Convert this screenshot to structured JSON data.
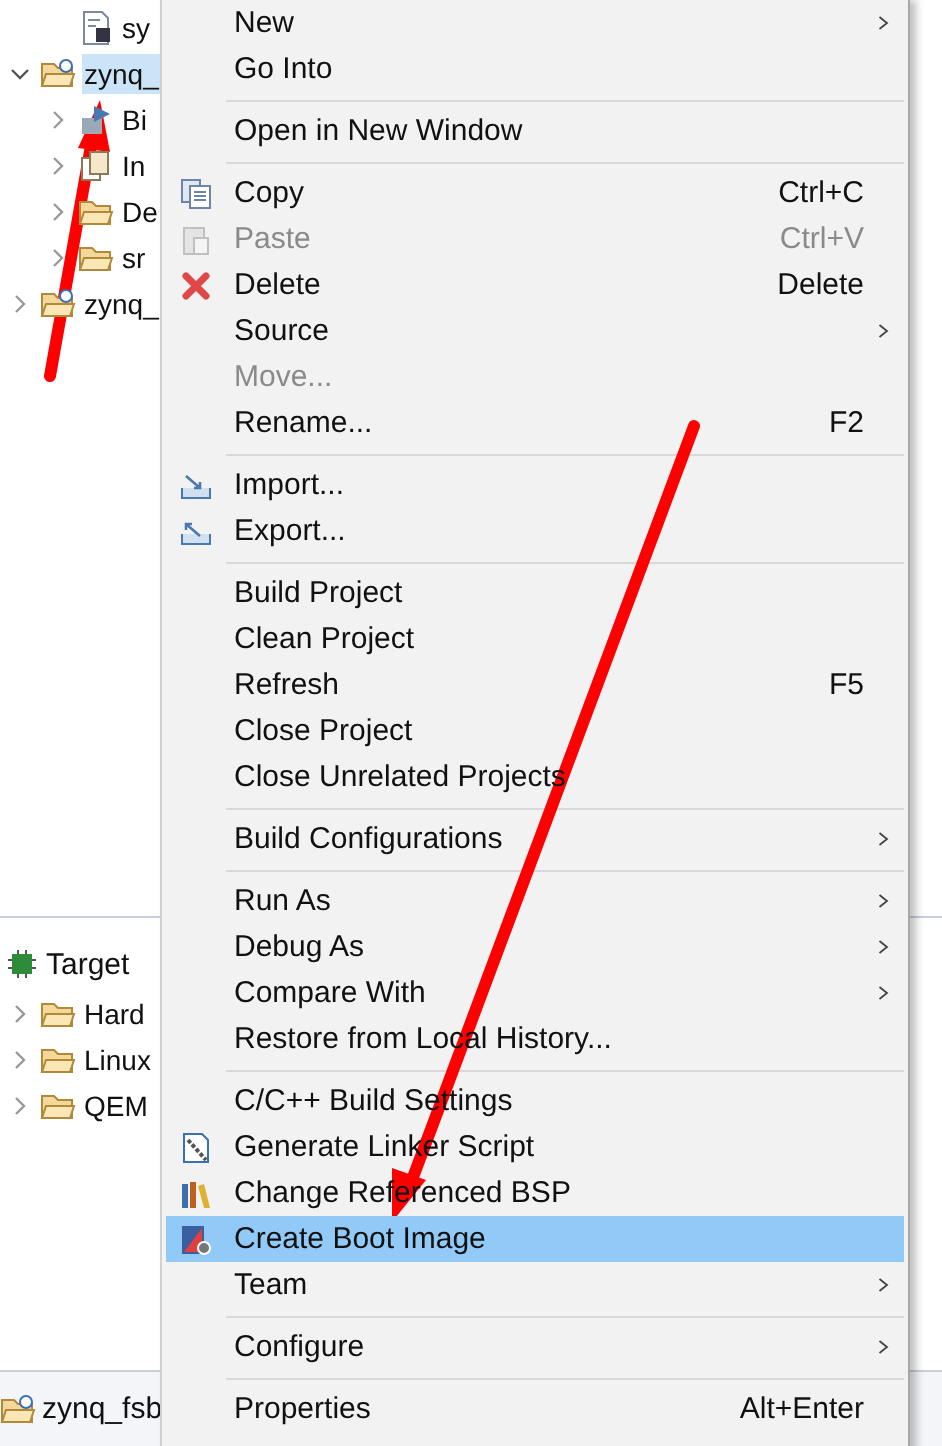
{
  "project_explorer": {
    "items": [
      {
        "label": "sy",
        "kind": "file",
        "selected": false
      },
      {
        "label": "zynq_",
        "kind": "project",
        "expanded": true,
        "selected": true,
        "children": [
          {
            "label": "Bi",
            "kind": "binaries",
            "expanded": false,
            "selected": false
          },
          {
            "label": "In",
            "kind": "includes",
            "expanded": false,
            "selected": false
          },
          {
            "label": "De",
            "kind": "folder",
            "expanded": false,
            "selected": false
          },
          {
            "label": "sr",
            "kind": "folder",
            "expanded": false,
            "selected": false
          }
        ]
      },
      {
        "label": "zynq_",
        "kind": "project",
        "expanded": false,
        "selected": false
      }
    ]
  },
  "target_panel": {
    "title": "Target",
    "items": [
      {
        "label": "Hard",
        "expanded": false
      },
      {
        "label": "Linux",
        "expanded": false
      },
      {
        "label": "QEM",
        "expanded": false
      }
    ]
  },
  "bottom_tab": {
    "label": "zynq_fsb"
  },
  "context_menu": {
    "items": [
      {
        "kind": "plain",
        "label": "New",
        "submenu": true,
        "disabled": false,
        "selected": false
      },
      {
        "kind": "plain",
        "label": "Go Into",
        "submenu": false,
        "disabled": false,
        "selected": false
      },
      {
        "kind": "separator"
      },
      {
        "kind": "plain",
        "label": "Open in New Window",
        "submenu": false,
        "disabled": false,
        "selected": false
      },
      {
        "kind": "separator"
      },
      {
        "kind": "copy",
        "label": "Copy",
        "shortcut": "Ctrl+C",
        "submenu": false,
        "disabled": false,
        "selected": false
      },
      {
        "kind": "paste",
        "label": "Paste",
        "shortcut": "Ctrl+V",
        "submenu": false,
        "disabled": true,
        "selected": false
      },
      {
        "kind": "delete",
        "label": "Delete",
        "shortcut": "Delete",
        "submenu": false,
        "disabled": false,
        "selected": false
      },
      {
        "kind": "plain",
        "label": "Source",
        "submenu": true,
        "disabled": false,
        "selected": false
      },
      {
        "kind": "plain",
        "label": "Move...",
        "submenu": false,
        "disabled": true,
        "selected": false
      },
      {
        "kind": "plain",
        "label": "Rename...",
        "shortcut": "F2",
        "submenu": false,
        "disabled": false,
        "selected": false
      },
      {
        "kind": "separator"
      },
      {
        "kind": "import",
        "label": "Import...",
        "submenu": false,
        "disabled": false,
        "selected": false
      },
      {
        "kind": "export",
        "label": "Export...",
        "submenu": false,
        "disabled": false,
        "selected": false
      },
      {
        "kind": "separator"
      },
      {
        "kind": "plain",
        "label": "Build Project",
        "submenu": false,
        "disabled": false,
        "selected": false
      },
      {
        "kind": "plain",
        "label": "Clean Project",
        "submenu": false,
        "disabled": false,
        "selected": false
      },
      {
        "kind": "plain",
        "label": "Refresh",
        "shortcut": "F5",
        "submenu": false,
        "disabled": false,
        "selected": false
      },
      {
        "kind": "plain",
        "label": "Close Project",
        "submenu": false,
        "disabled": false,
        "selected": false
      },
      {
        "kind": "plain",
        "label": "Close Unrelated Projects",
        "submenu": false,
        "disabled": false,
        "selected": false
      },
      {
        "kind": "separator"
      },
      {
        "kind": "plain",
        "label": "Build Configurations",
        "submenu": true,
        "disabled": false,
        "selected": false
      },
      {
        "kind": "separator"
      },
      {
        "kind": "plain",
        "label": "Run As",
        "submenu": true,
        "disabled": false,
        "selected": false
      },
      {
        "kind": "plain",
        "label": "Debug As",
        "submenu": true,
        "disabled": false,
        "selected": false
      },
      {
        "kind": "plain",
        "label": "Compare With",
        "submenu": true,
        "disabled": false,
        "selected": false
      },
      {
        "kind": "plain",
        "label": "Restore from Local History...",
        "submenu": false,
        "disabled": false,
        "selected": false
      },
      {
        "kind": "separator"
      },
      {
        "kind": "plain",
        "label": "C/C++ Build Settings",
        "submenu": false,
        "disabled": false,
        "selected": false
      },
      {
        "kind": "linker",
        "label": "Generate Linker Script",
        "submenu": false,
        "disabled": false,
        "selected": false
      },
      {
        "kind": "bsp",
        "label": "Change Referenced BSP",
        "submenu": false,
        "disabled": false,
        "selected": false
      },
      {
        "kind": "boot",
        "label": "Create Boot Image",
        "submenu": false,
        "disabled": false,
        "selected": true
      },
      {
        "kind": "plain",
        "label": "Team",
        "submenu": true,
        "disabled": false,
        "selected": false
      },
      {
        "kind": "separator"
      },
      {
        "kind": "plain",
        "label": "Configure",
        "submenu": true,
        "disabled": false,
        "selected": false
      },
      {
        "kind": "separator"
      },
      {
        "kind": "plain",
        "label": "Properties",
        "shortcut": "Alt+Enter",
        "submenu": false,
        "disabled": false,
        "selected": false
      }
    ]
  }
}
